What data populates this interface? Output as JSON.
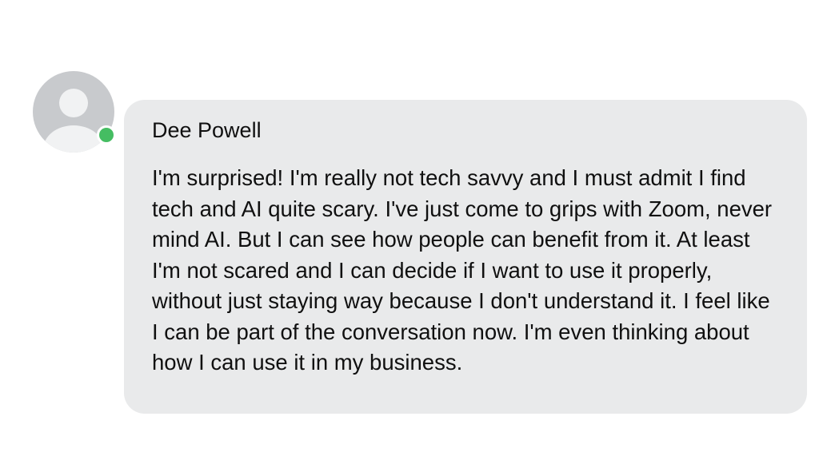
{
  "comment": {
    "author": "Dee Powell",
    "text": "I'm surprised! I'm really not tech savvy and I must admit I find tech and AI quite scary. I've just come to grips with Zoom, never mind AI. But I can see how people can benefit from it. At least I'm not scared and I can decide if I want to use it properly, without just staying way because I don't understand it. I feel like I can be part of the conversation now. I'm even thinking about how I can use it in my business.",
    "avatar_icon": "default-user-avatar-icon",
    "presence_status": "online"
  },
  "colors": {
    "bubble_background": "#e9eaeb",
    "text": "#101010",
    "presence_online": "#45bd62",
    "avatar_background": "#c8cacd",
    "avatar_figure": "#f1f2f3"
  }
}
